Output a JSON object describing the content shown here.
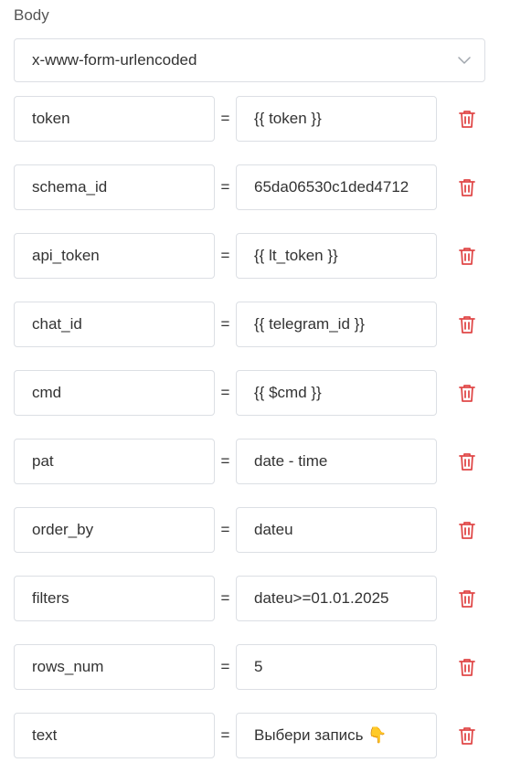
{
  "body_label": "Body",
  "content_type": "x-www-form-urlencoded",
  "colors": {
    "border": "#dcdfe4",
    "delete": "#e04848",
    "text": "#333333"
  },
  "params": [
    {
      "key": "token",
      "eq": "=",
      "value": "{{ token }}"
    },
    {
      "key": "schema_id",
      "eq": "=",
      "value": "65da06530c1ded4712"
    },
    {
      "key": "api_token",
      "eq": "=",
      "value": "{{ lt_token }}"
    },
    {
      "key": "chat_id",
      "eq": "=",
      "value": "{{ telegram_id }}"
    },
    {
      "key": "cmd",
      "eq": "=",
      "value": "{{ $cmd }}"
    },
    {
      "key": "pat",
      "eq": "=",
      "value": "date - time"
    },
    {
      "key": "order_by",
      "eq": "=",
      "value": "dateu"
    },
    {
      "key": "filters",
      "eq": "=",
      "value": "dateu>=01.01.2025"
    },
    {
      "key": "rows_num",
      "eq": "=",
      "value": "5"
    },
    {
      "key": "text",
      "eq": "=",
      "value": "Выбери запись 👇"
    }
  ]
}
